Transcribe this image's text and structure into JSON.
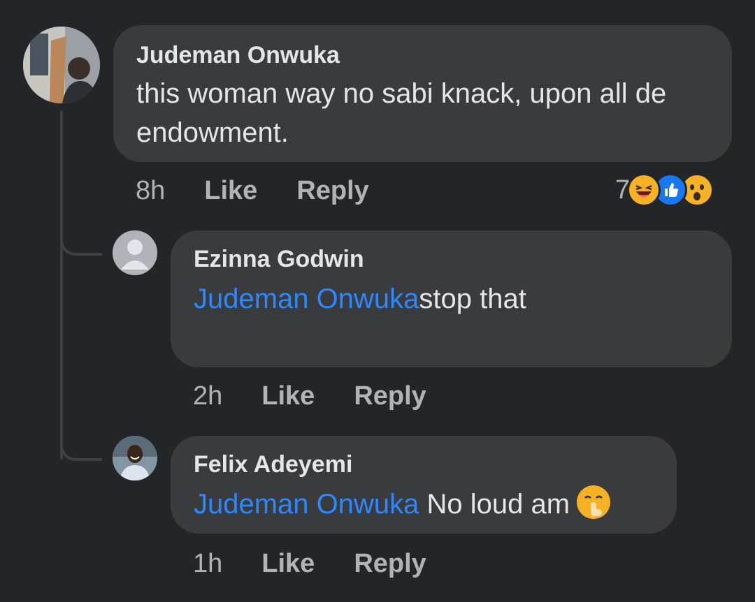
{
  "comment": {
    "author": "Judeman Onwuka",
    "text": "this woman way no sabi knack, upon all de endowment.",
    "time": "8h",
    "like_label": "Like",
    "reply_label": "Reply",
    "reaction_count": "7",
    "reactions": [
      "haha-icon",
      "like-icon",
      "wow-icon"
    ]
  },
  "replies": [
    {
      "author": "Ezinna Godwin",
      "mention": "Judeman Onwuka",
      "text": "Judeman Onwuka stop that",
      "time": "2h",
      "like_label": "Like",
      "reply_label": "Reply"
    },
    {
      "author": "Felix Adeyemi",
      "mention": "Judeman Onwuka",
      "text": " No loud am",
      "time": "1h",
      "like_label": "Like",
      "reply_label": "Reply",
      "emoji": "shushing-face-icon"
    }
  ],
  "colors": {
    "background": "#242526",
    "bubble": "#3a3b3c",
    "mention": "#2d88ff",
    "secondary_text": "#b0b3b8",
    "primary_text": "#e4e6eb"
  }
}
